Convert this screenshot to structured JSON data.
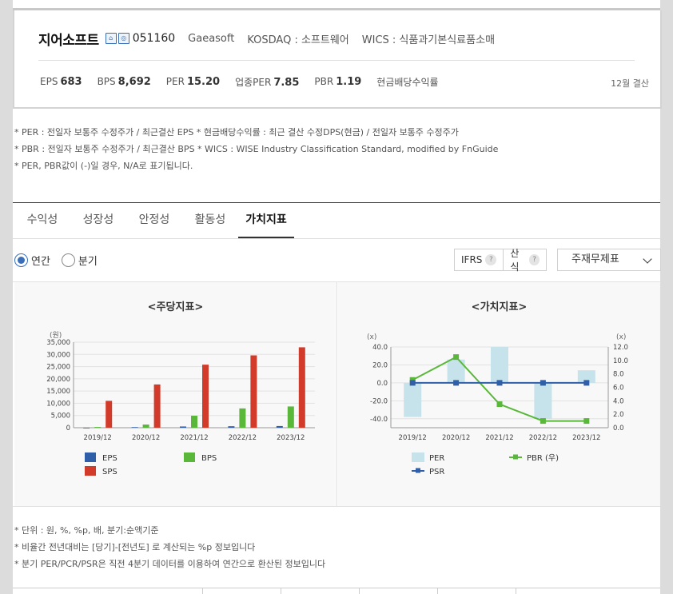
{
  "company": {
    "name": "지어소프트",
    "code": "051160",
    "english_name": "Gaeasoft",
    "market": "KOSDAQ : 소프트웨어",
    "wics": "WICS : 식품과기본식료품소매",
    "icon_1": "home-icon",
    "icon_2": "ir-icon"
  },
  "metrics": [
    {
      "label": "EPS",
      "value": "683"
    },
    {
      "label": "BPS",
      "value": "8,692"
    },
    {
      "label": "PER",
      "value": "15.20"
    },
    {
      "label": "업종PER",
      "value": "7.85"
    },
    {
      "label": "PBR",
      "value": "1.19"
    },
    {
      "label": "현금배당수익률",
      "value": ""
    }
  ],
  "fiscal_label": "12월 결산",
  "notes": [
    "* PER : 전일자 보통주 수정주가 / 최근결산 EPS * 현금배당수익률 : 최근 결산 수정DPS(현금) / 전일자 보통주 수정주가",
    "* PBR : 전일자 보통주 수정주가 / 최근결산 BPS * WICS : WISE Industry Classification Standard, modified by FnGuide",
    "* PER, PBR값이 (-)일 경우, N/A로 표기됩니다."
  ],
  "tabs": [
    {
      "label": "수익성",
      "active": false
    },
    {
      "label": "성장성",
      "active": false
    },
    {
      "label": "안정성",
      "active": false
    },
    {
      "label": "활동성",
      "active": false
    },
    {
      "label": "가치지표",
      "active": true
    }
  ],
  "period": {
    "annual": "연간",
    "quarter": "분기",
    "selected": "annual"
  },
  "options": {
    "ifrs": "IFRS",
    "calc": "산식",
    "help": "?"
  },
  "statement_select": {
    "value": "주재무제표"
  },
  "chart_data": [
    {
      "type": "bar",
      "title": "<주당지표>",
      "ylabel": "(원)",
      "categories": [
        "2019/12",
        "2020/12",
        "2021/12",
        "2022/12",
        "2023/12"
      ],
      "ylim": [
        0,
        35000
      ],
      "yticks": [
        0,
        5000,
        10000,
        15000,
        20000,
        25000,
        30000,
        35000
      ],
      "series": [
        {
          "name": "EPS",
          "color": "#2f5fa8",
          "values": [
            -60,
            250,
            500,
            600,
            683
          ]
        },
        {
          "name": "BPS",
          "color": "#59b83a",
          "values": [
            300,
            1300,
            4900,
            7900,
            8692
          ]
        },
        {
          "name": "SPS",
          "color": "#d23a2a",
          "values": [
            11000,
            17700,
            25800,
            29600,
            32900
          ]
        }
      ],
      "legend": "bottom"
    },
    {
      "type": "bar",
      "title": "<가치지표>",
      "ylabel": "(x)",
      "y2label": "(x)",
      "categories": [
        "2019/12",
        "2020/12",
        "2021/12",
        "2022/12",
        "2023/12"
      ],
      "ylim": [
        -50,
        40
      ],
      "yticks": [
        -40,
        -20,
        0,
        20,
        40
      ],
      "y2lim": [
        0,
        12
      ],
      "y2ticks": [
        0,
        2,
        4,
        6,
        8,
        10,
        12
      ],
      "series": [
        {
          "name": "PER",
          "kind": "bar",
          "axis": "left",
          "color": "#c6e2ea",
          "values": [
            -38,
            26,
            40,
            -40,
            14
          ]
        },
        {
          "name": "PBR (우)",
          "kind": "line",
          "axis": "right",
          "color": "#59b83a",
          "values": [
            7.1,
            10.5,
            3.5,
            1.0,
            1.0
          ]
        },
        {
          "name": "PSR",
          "kind": "line",
          "axis": "left",
          "color": "#2f5fa8",
          "values": [
            0,
            0,
            0,
            0,
            0
          ]
        }
      ],
      "legend": "bottom"
    }
  ],
  "bottom_notes": [
    "* 단위 : 원, %, %p, 배, 분기:순액기준",
    "* 비율간 전년대비는 [당기]-[전년도] 로 계산되는 %p 정보입니다",
    "* 분기 PER/PCR/PSR은 직전 4분기 데이터를 이용하여 연간으로 환산된 정보입니다"
  ]
}
